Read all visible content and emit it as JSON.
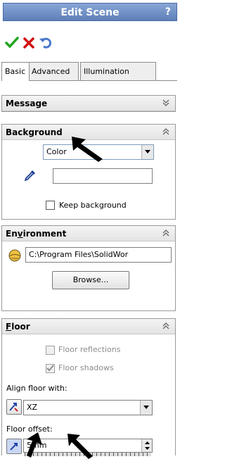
{
  "window": {
    "title": "Edit Scene",
    "help": "?"
  },
  "actions": [
    {
      "icon": "ok-check-icon",
      "color": "#1fa51f"
    },
    {
      "icon": "cancel-x-icon",
      "color": "#d01010"
    },
    {
      "icon": "undo-icon",
      "color": "#4a78c8"
    }
  ],
  "tabs": [
    {
      "label": "Basic",
      "active": true
    },
    {
      "label": "Advanced",
      "active": false
    },
    {
      "label": "Illumination",
      "active": false
    }
  ],
  "message": {
    "title": "Message",
    "state": "collapsed"
  },
  "background": {
    "title": "Background",
    "type_select": "Color",
    "color_field_value": "",
    "keep_background_label": "Keep background",
    "keep_background_checked": false
  },
  "environment": {
    "title": "Environment",
    "title_underline_char": "v",
    "path": "C:\\Program Files\\SolidWor",
    "browse_label": "Browse..."
  },
  "floor": {
    "title": "Floor",
    "floor_reflections_label": "Floor reflections",
    "floor_reflections_checked": false,
    "floor_shadows_label": "Floor shadows",
    "floor_shadows_checked": true,
    "align_label": "Align floor with:",
    "align_value": "XZ",
    "offset_label": "Floor offset:",
    "offset_value": "5mm"
  },
  "colors": {
    "title_bar": "#6f8fc4",
    "accent_border": "#7f9db9"
  }
}
